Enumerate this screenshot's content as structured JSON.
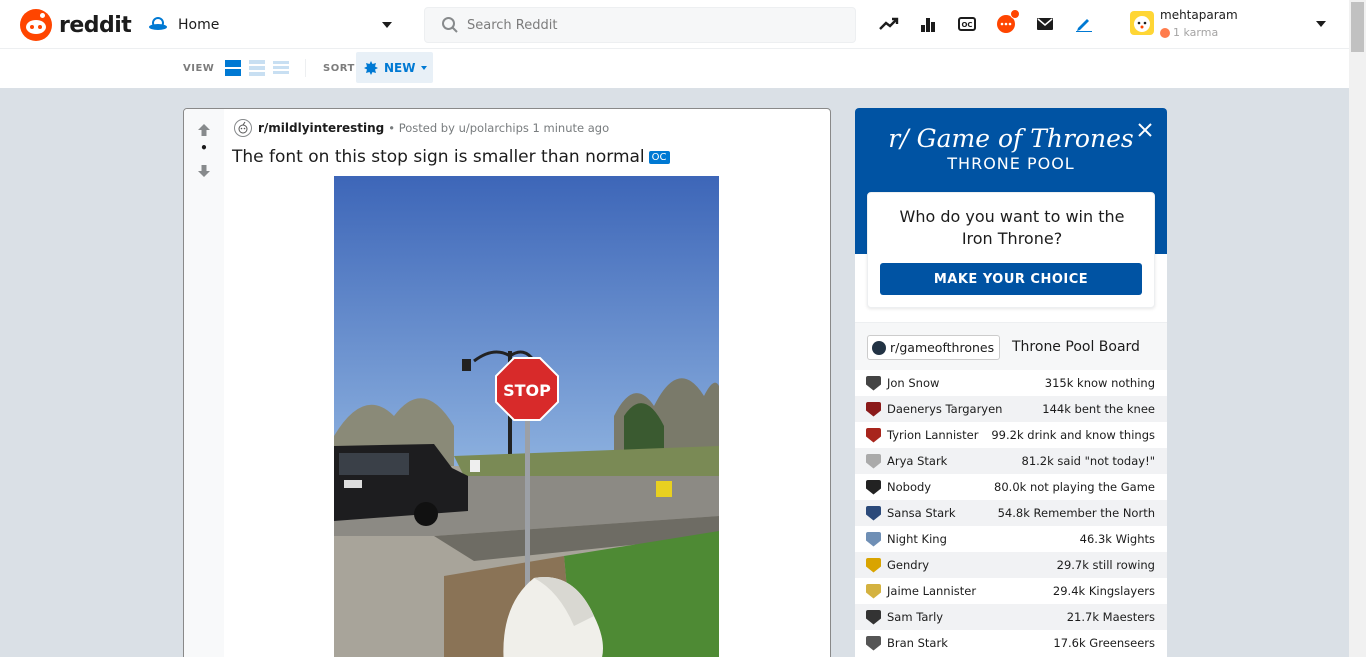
{
  "header": {
    "logo_text": "reddit",
    "home_label": "Home",
    "search_placeholder": "Search Reddit",
    "user": {
      "name": "mehtaparam",
      "karma": "1 karma"
    },
    "icons": [
      "trending-icon",
      "stats-icon",
      "oc-icon",
      "chat-icon",
      "mail-icon",
      "pencil-icon"
    ]
  },
  "subbar": {
    "view_label": "VIEW",
    "sort_label": "SORT",
    "sort_value": "NEW"
  },
  "post": {
    "vote_count": "•",
    "subreddit": "r/mildlyinteresting",
    "meta": "• Posted by u/polarchips 1 minute ago",
    "title": "The font on this stop sign is smaller than normal",
    "tag": "OC",
    "image_sign_text": "STOP"
  },
  "widget": {
    "title": "r/ Game of Thrones",
    "subtitle": "THRONE POOL",
    "question": "Who do you want to win the Iron Throne?",
    "button": "MAKE YOUR CHOICE",
    "sub_pill": "r/gameofthrones",
    "board_title": "Throne Pool Board",
    "rows": [
      {
        "name": "Jon Snow",
        "value": "315k know nothing",
        "color": "#444"
      },
      {
        "name": "Daenerys Targaryen",
        "value": "144k bent the knee",
        "color": "#8b1a1a"
      },
      {
        "name": "Tyrion Lannister",
        "value": "99.2k drink and know things",
        "color": "#a8251c"
      },
      {
        "name": "Arya Stark",
        "value": "81.2k said \"not today!\"",
        "color": "#aaa"
      },
      {
        "name": "Nobody",
        "value": "80.0k not playing the Game",
        "color": "#222"
      },
      {
        "name": "Sansa Stark",
        "value": "54.8k Remember the North",
        "color": "#2c4a7a"
      },
      {
        "name": "Night King",
        "value": "46.3k Wights",
        "color": "#6f8fb5"
      },
      {
        "name": "Gendry",
        "value": "29.7k still rowing",
        "color": "#d9a400"
      },
      {
        "name": "Jaime Lannister",
        "value": "29.4k Kingslayers",
        "color": "#d4b240"
      },
      {
        "name": "Sam Tarly",
        "value": "21.7k Maesters",
        "color": "#333"
      },
      {
        "name": "Bran Stark",
        "value": "17.6k Greenseers",
        "color": "#555"
      }
    ]
  },
  "colors": {
    "brand": "#ff4500",
    "accent": "#0079d3",
    "got_blue": "#0053a3",
    "background": "#dae0e6"
  }
}
